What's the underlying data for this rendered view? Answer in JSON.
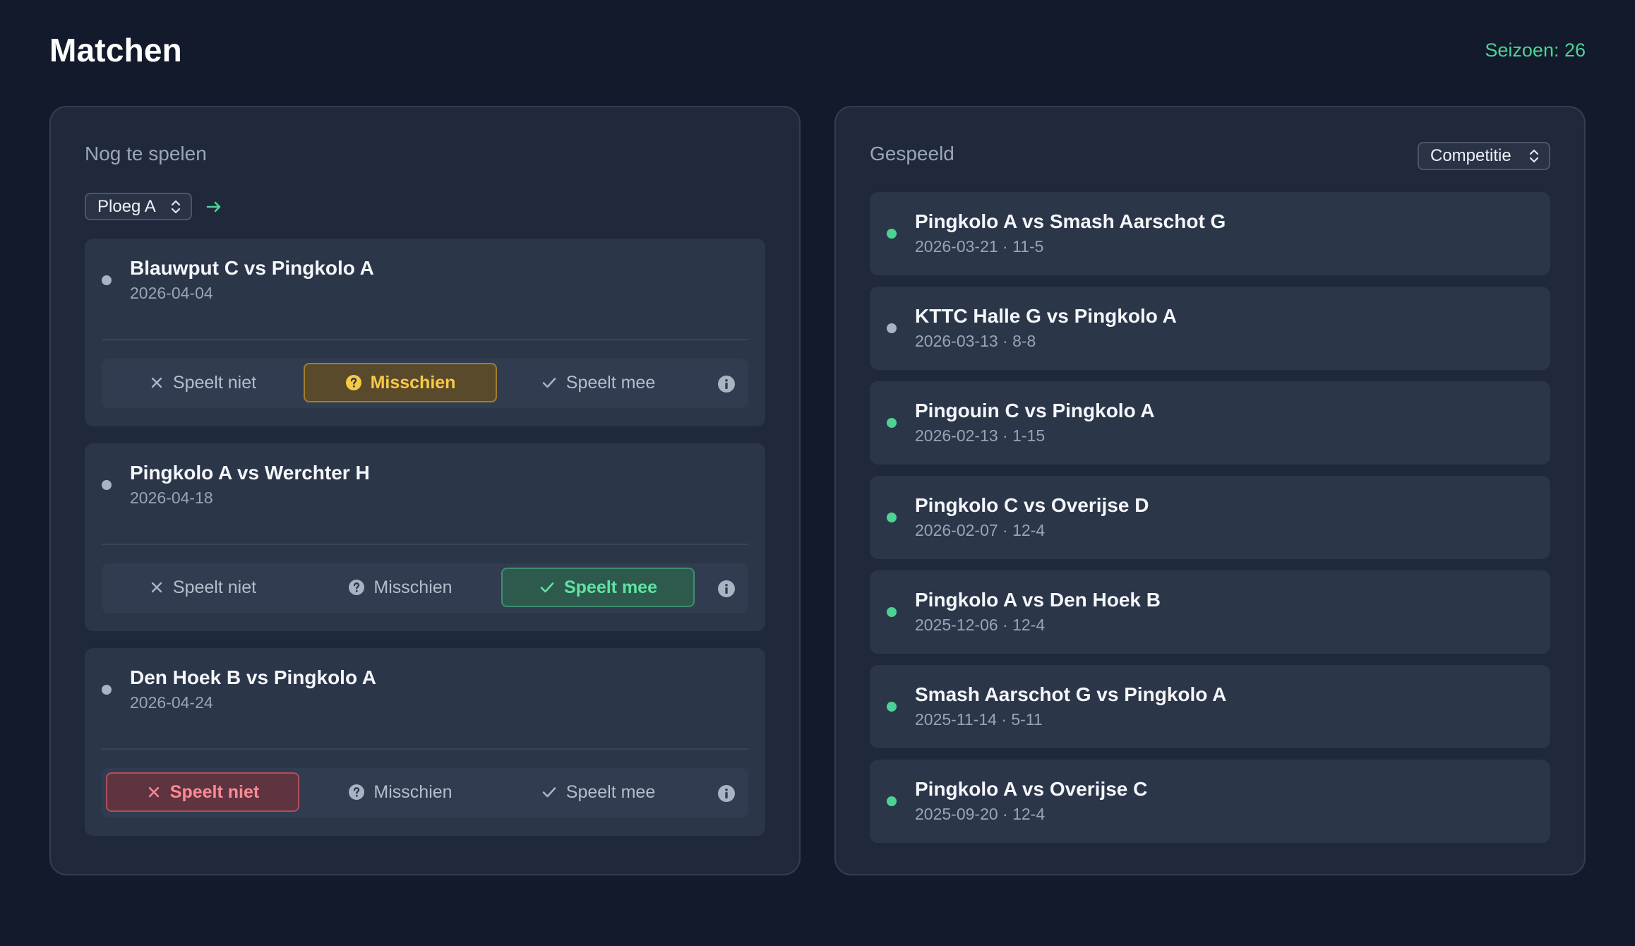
{
  "header": {
    "title": "Matchen",
    "season": "Seizoen: 26"
  },
  "upcoming": {
    "title": "Nog te spelen",
    "team_select": "Ploeg A",
    "options": {
      "no": "Speelt niet",
      "maybe": "Misschien",
      "yes": "Speelt mee"
    },
    "matches": [
      {
        "title": "Blauwput C vs Pingkolo A",
        "date": "2026-04-04",
        "status": "maybe"
      },
      {
        "title": "Pingkolo A vs Werchter H",
        "date": "2026-04-18",
        "status": "yes"
      },
      {
        "title": "Den Hoek B vs Pingkolo A",
        "date": "2026-04-24",
        "status": "no"
      }
    ]
  },
  "played": {
    "title": "Gespeeld",
    "type_select": "Competitie",
    "matches": [
      {
        "title": "Pingkolo A vs Smash Aarschot G",
        "meta": "2026-03-21 · 11-5",
        "result": "win"
      },
      {
        "title": "KTTC Halle G vs Pingkolo A",
        "meta": "2026-03-13 · 8-8",
        "result": "draw"
      },
      {
        "title": "Pingouin C vs Pingkolo A",
        "meta": "2026-02-13 · 1-15",
        "result": "win"
      },
      {
        "title": "Pingkolo C vs Overijse D",
        "meta": "2026-02-07 · 12-4",
        "result": "win"
      },
      {
        "title": "Pingkolo A vs Den Hoek B",
        "meta": "2025-12-06 · 12-4",
        "result": "win"
      },
      {
        "title": "Smash Aarschot G vs Pingkolo A",
        "meta": "2025-11-14 · 5-11",
        "result": "win"
      },
      {
        "title": "Pingkolo A vs Overijse C",
        "meta": "2025-09-20 · 12-4",
        "result": "win"
      }
    ]
  },
  "colors": {
    "win": "#4cd393",
    "draw": "#aab3c4",
    "accent": "#4cd393"
  },
  "icons": {
    "no": "x-icon",
    "maybe": "question-circle-icon",
    "yes": "check-icon",
    "info": "info-circle-icon",
    "go": "arrow-right-icon",
    "select": "chevron-updown-icon"
  }
}
